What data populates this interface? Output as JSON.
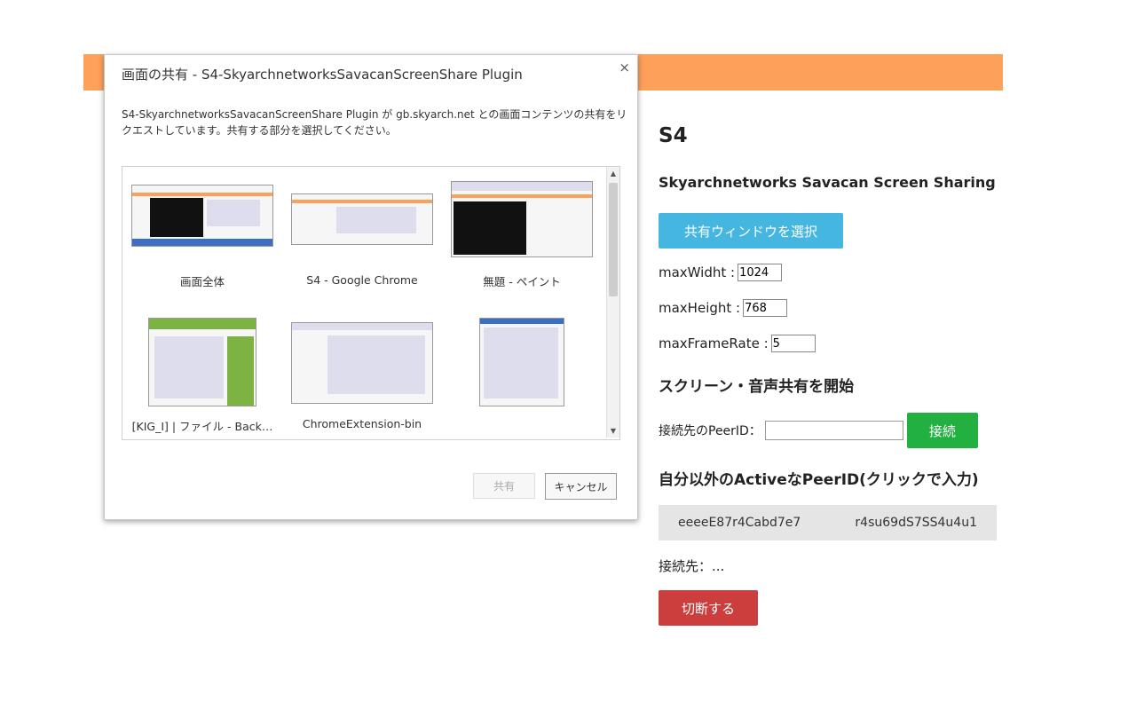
{
  "page": {
    "title": "S4",
    "subtitle": "Skyarchnetworks Savacan Screen Sharing",
    "select_window_button": "共有ウィンドウを選択",
    "fields": [
      {
        "label": "maxWidht :",
        "value": "1024"
      },
      {
        "label": "maxHeight :",
        "value": "768"
      },
      {
        "label": "maxFrameRate :",
        "value": "5"
      }
    ],
    "start_section_title": "スクリーン・音声共有を開始",
    "peer_id_label": "接続先のPeerID：",
    "connect_button": "接続",
    "active_peers_title": "自分以外のActiveなPeerID(クリックで入力)",
    "active_peers": [
      "eeeeE87r4Cabd7e7",
      "r4su69dS7SS4u4u1"
    ],
    "connection_status": "接続先：...",
    "disconnect_button": "切断する"
  },
  "dialog": {
    "title": "画面の共有 - S4-SkyarchnetworksSavacanScreenShare Plugin",
    "close_glyph": "×",
    "description": "S4-SkyarchnetworksSavacanScreenShare Plugin が gb.skyarch.net との画面コンテンツの共有をリクエストしています。共有する部分を選択してください。",
    "sources": [
      {
        "label": "画面全体"
      },
      {
        "label": "S4 - Google Chrome"
      },
      {
        "label": "無題 - ペイント"
      },
      {
        "label": "[KIG_I] | ファイル - Back…"
      },
      {
        "label": "ChromeExtension-bin"
      },
      {
        "label": ""
      }
    ],
    "share_button": "共有",
    "cancel_button": "キャンセル"
  },
  "colors": {
    "orange_bar": "#fda05a",
    "select_button": "#45b6e0",
    "connect_button": "#22b140",
    "disconnect_button": "#cc3d3d"
  }
}
